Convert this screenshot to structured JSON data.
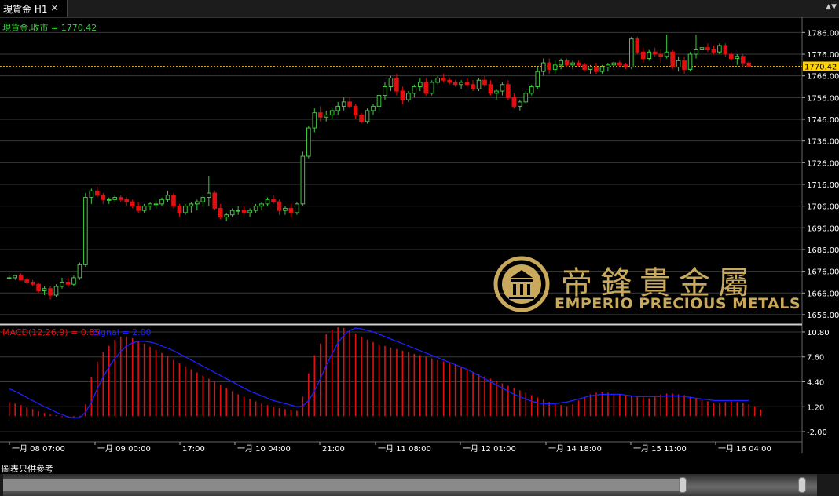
{
  "tab": {
    "title": "現貨金 H1",
    "close_label": "×",
    "menu_label": "▲▼"
  },
  "footer": {
    "note": "圖表只供參考"
  },
  "logo": {
    "chinese": "帝鋒貴金屬",
    "english": "EMPERIO PRECIOUS METALS"
  },
  "colors": {
    "bull": "#3fc93f",
    "bear": "#e01010",
    "grid": "#3a3a3a",
    "price_line": "#e0a020",
    "signal": "#1e1eff",
    "macd": "#e01010",
    "axis_text": "#ffffff",
    "date_text": "#ffdd00"
  },
  "chart_data": [
    {
      "type": "candlestick",
      "title": "現貨金,收市 = 1770.42",
      "symbol": "現貨金",
      "timeframe": "H1",
      "last_price": 1770.42,
      "ylim": [
        1652,
        1793
      ],
      "yticks": [
        1786.0,
        1776.0,
        1766.0,
        1756.0,
        1746.0,
        1736.0,
        1726.0,
        1716.0,
        1706.0,
        1696.0,
        1686.0,
        1676.0,
        1666.0,
        1656.0
      ],
      "xtick_labels": [
        "一月 08 07:00",
        "一月 09 00:00",
        "17:00",
        "一月 10 04:00",
        "21:00",
        "一月 11 08:00",
        "一月 12 01:00",
        "一月 14 18:00",
        "一月 15 11:00",
        "一月 16 04:00"
      ],
      "ohlc": [
        [
          1673,
          1674,
          1672,
          1673
        ],
        [
          1673,
          1674,
          1672,
          1674
        ],
        [
          1674,
          1675,
          1672,
          1672
        ],
        [
          1672,
          1673,
          1670,
          1671
        ],
        [
          1671,
          1672,
          1669,
          1670
        ],
        [
          1670,
          1671,
          1666,
          1667
        ],
        [
          1667,
          1669,
          1665,
          1668
        ],
        [
          1668,
          1669,
          1663,
          1665
        ],
        [
          1665,
          1670,
          1664,
          1669
        ],
        [
          1669,
          1673,
          1668,
          1671
        ],
        [
          1671,
          1673,
          1669,
          1670
        ],
        [
          1670,
          1674,
          1669,
          1673
        ],
        [
          1673,
          1680,
          1672,
          1679
        ],
        [
          1679,
          1712,
          1678,
          1710
        ],
        [
          1710,
          1714,
          1707,
          1713
        ],
        [
          1713,
          1715,
          1710,
          1711
        ],
        [
          1711,
          1712,
          1707,
          1709
        ],
        [
          1709,
          1710,
          1707,
          1709
        ],
        [
          1709,
          1711,
          1708,
          1710
        ],
        [
          1710,
          1711,
          1708,
          1709
        ],
        [
          1709,
          1710,
          1706,
          1708
        ],
        [
          1708,
          1709,
          1705,
          1706
        ],
        [
          1706,
          1708,
          1703,
          1704
        ],
        [
          1704,
          1707,
          1703,
          1706
        ],
        [
          1706,
          1708,
          1704,
          1707
        ],
        [
          1707,
          1709,
          1705,
          1707
        ],
        [
          1707,
          1710,
          1706,
          1709
        ],
        [
          1709,
          1713,
          1708,
          1711
        ],
        [
          1711,
          1712,
          1705,
          1706
        ],
        [
          1706,
          1707,
          1701,
          1703
        ],
        [
          1703,
          1707,
          1702,
          1706
        ],
        [
          1706,
          1708,
          1703,
          1707
        ],
        [
          1707,
          1709,
          1704,
          1708
        ],
        [
          1708,
          1711,
          1706,
          1710
        ],
        [
          1710,
          1720,
          1706,
          1712
        ],
        [
          1712,
          1713,
          1704,
          1705
        ],
        [
          1705,
          1707,
          1700,
          1701
        ],
        [
          1701,
          1703,
          1699,
          1702
        ],
        [
          1702,
          1705,
          1701,
          1704
        ],
        [
          1704,
          1706,
          1702,
          1704
        ],
        [
          1704,
          1706,
          1702,
          1703
        ],
        [
          1703,
          1705,
          1701,
          1704
        ],
        [
          1704,
          1707,
          1703,
          1706
        ],
        [
          1706,
          1708,
          1704,
          1707
        ],
        [
          1707,
          1710,
          1706,
          1709
        ],
        [
          1709,
          1711,
          1707,
          1708
        ],
        [
          1708,
          1709,
          1702,
          1704
        ],
        [
          1704,
          1706,
          1702,
          1705
        ],
        [
          1705,
          1707,
          1701,
          1703
        ],
        [
          1703,
          1708,
          1702,
          1707
        ],
        [
          1707,
          1731,
          1706,
          1729
        ],
        [
          1729,
          1743,
          1728,
          1742
        ],
        [
          1742,
          1751,
          1740,
          1749
        ],
        [
          1749,
          1752,
          1745,
          1747
        ],
        [
          1747,
          1750,
          1745,
          1748
        ],
        [
          1748,
          1751,
          1746,
          1750
        ],
        [
          1750,
          1754,
          1748,
          1752
        ],
        [
          1752,
          1756,
          1750,
          1754
        ],
        [
          1754,
          1756,
          1751,
          1752
        ],
        [
          1752,
          1753,
          1746,
          1748
        ],
        [
          1748,
          1749,
          1744,
          1745
        ],
        [
          1745,
          1751,
          1744,
          1750
        ],
        [
          1750,
          1753,
          1748,
          1752
        ],
        [
          1752,
          1758,
          1750,
          1757
        ],
        [
          1757,
          1763,
          1755,
          1761
        ],
        [
          1761,
          1766,
          1759,
          1765
        ],
        [
          1765,
          1767,
          1757,
          1759
        ],
        [
          1759,
          1761,
          1753,
          1755
        ],
        [
          1755,
          1759,
          1754,
          1758
        ],
        [
          1758,
          1762,
          1756,
          1761
        ],
        [
          1761,
          1765,
          1759,
          1763
        ],
        [
          1763,
          1765,
          1757,
          1758
        ],
        [
          1758,
          1764,
          1757,
          1763
        ],
        [
          1763,
          1766,
          1762,
          1765
        ],
        [
          1765,
          1767,
          1763,
          1764
        ],
        [
          1764,
          1765,
          1762,
          1763
        ],
        [
          1763,
          1764,
          1761,
          1762
        ],
        [
          1762,
          1764,
          1760,
          1763
        ],
        [
          1763,
          1765,
          1761,
          1762
        ],
        [
          1762,
          1764,
          1759,
          1760
        ],
        [
          1760,
          1765,
          1759,
          1764
        ],
        [
          1764,
          1766,
          1761,
          1762
        ],
        [
          1762,
          1764,
          1757,
          1758
        ],
        [
          1758,
          1760,
          1755,
          1759
        ],
        [
          1759,
          1763,
          1757,
          1762
        ],
        [
          1762,
          1764,
          1755,
          1756
        ],
        [
          1756,
          1758,
          1751,
          1752
        ],
        [
          1752,
          1755,
          1750,
          1754
        ],
        [
          1754,
          1759,
          1753,
          1758
        ],
        [
          1758,
          1762,
          1757,
          1761
        ],
        [
          1761,
          1770,
          1760,
          1768
        ],
        [
          1768,
          1774,
          1766,
          1772
        ],
        [
          1772,
          1774,
          1767,
          1769
        ],
        [
          1769,
          1773,
          1767,
          1771
        ],
        [
          1771,
          1774,
          1769,
          1773
        ],
        [
          1773,
          1774,
          1770,
          1771
        ],
        [
          1771,
          1773,
          1769,
          1772
        ],
        [
          1772,
          1773,
          1770,
          1771
        ],
        [
          1771,
          1772,
          1768,
          1769
        ],
        [
          1769,
          1771,
          1767,
          1770
        ],
        [
          1770,
          1772,
          1767,
          1768
        ],
        [
          1768,
          1771,
          1767,
          1770
        ],
        [
          1770,
          1772,
          1768,
          1771
        ],
        [
          1771,
          1773,
          1769,
          1772
        ],
        [
          1772,
          1773,
          1770,
          1771
        ],
        [
          1771,
          1772,
          1769,
          1770
        ],
        [
          1770,
          1784,
          1769,
          1783
        ],
        [
          1783,
          1784,
          1776,
          1777
        ],
        [
          1777,
          1779,
          1772,
          1774
        ],
        [
          1774,
          1778,
          1773,
          1777
        ],
        [
          1777,
          1779,
          1775,
          1776
        ],
        [
          1776,
          1778,
          1772,
          1775
        ],
        [
          1775,
          1785,
          1774,
          1777
        ],
        [
          1777,
          1778,
          1769,
          1770
        ],
        [
          1770,
          1775,
          1768,
          1773
        ],
        [
          1773,
          1775,
          1767,
          1769
        ],
        [
          1769,
          1777,
          1768,
          1776
        ],
        [
          1776,
          1785,
          1774,
          1778
        ],
        [
          1778,
          1780,
          1776,
          1779
        ],
        [
          1779,
          1781,
          1777,
          1778
        ],
        [
          1778,
          1780,
          1776,
          1777
        ],
        [
          1777,
          1781,
          1776,
          1780
        ],
        [
          1780,
          1781,
          1775,
          1776
        ],
        [
          1776,
          1777,
          1773,
          1774
        ],
        [
          1774,
          1776,
          1771,
          1775
        ],
        [
          1775,
          1776,
          1770,
          1772
        ],
        [
          1772,
          1773,
          1770,
          1770.42
        ]
      ]
    },
    {
      "type": "macd",
      "title": "MACD(12,26,9) = 0.85",
      "signal_label": "Signal = 2.00",
      "macd": 0.85,
      "signal": 2.0,
      "ylim": [
        -3.2,
        11.6
      ],
      "yticks": [
        10.8,
        7.6,
        4.4,
        1.2,
        -2.0
      ],
      "histogram": [
        1.8,
        1.6,
        1.4,
        1.1,
        0.9,
        0.6,
        0.4,
        0.2,
        0.1,
        0.0,
        -0.1,
        -0.2,
        -0.1,
        1.5,
        5.0,
        7.0,
        8.2,
        9.0,
        9.8,
        10.2,
        10.2,
        10.0,
        9.7,
        9.3,
        8.9,
        8.5,
        8.1,
        7.7,
        7.2,
        6.8,
        6.4,
        6.0,
        5.6,
        5.2,
        4.8,
        4.4,
        4.0,
        3.6,
        3.2,
        2.8,
        2.5,
        2.2,
        1.9,
        1.6,
        1.4,
        1.2,
        1.0,
        0.9,
        0.8,
        0.7,
        2.5,
        5.5,
        7.8,
        9.3,
        10.5,
        11.1,
        11.4,
        11.3,
        11.0,
        10.6,
        10.2,
        9.8,
        9.5,
        9.2,
        9.0,
        8.8,
        8.6,
        8.4,
        8.2,
        8.0,
        7.8,
        7.6,
        7.4,
        7.2,
        7.0,
        6.8,
        6.6,
        6.3,
        6.0,
        5.7,
        5.4,
        5.1,
        4.8,
        4.5,
        4.2,
        3.9,
        3.6,
        3.3,
        3.0,
        2.7,
        2.4,
        2.1,
        1.8,
        1.6,
        1.4,
        1.3,
        1.5,
        2.0,
        2.5,
        2.8,
        3.0,
        3.1,
        3.0,
        2.9,
        2.8,
        2.7,
        2.6,
        2.5,
        2.4,
        2.3,
        2.6,
        2.8,
        2.9,
        2.9,
        2.8,
        2.7,
        2.5,
        2.3,
        2.1,
        1.9,
        1.7,
        1.6,
        1.8,
        1.9,
        1.8,
        1.7,
        1.5,
        1.3,
        0.85
      ],
      "signal_series": [
        3.5,
        3.2,
        2.8,
        2.4,
        2.0,
        1.6,
        1.2,
        0.9,
        0.5,
        0.2,
        -0.1,
        -0.2,
        -0.2,
        0.5,
        1.8,
        3.5,
        5.0,
        6.3,
        7.4,
        8.3,
        9.0,
        9.4,
        9.6,
        9.6,
        9.5,
        9.3,
        9.0,
        8.7,
        8.4,
        8.0,
        7.6,
        7.2,
        6.8,
        6.4,
        6.0,
        5.6,
        5.2,
        4.8,
        4.4,
        4.0,
        3.6,
        3.2,
        2.9,
        2.6,
        2.3,
        2.0,
        1.8,
        1.6,
        1.4,
        1.2,
        1.3,
        2.0,
        3.2,
        4.8,
        6.5,
        8.0,
        9.4,
        10.4,
        11.0,
        11.3,
        11.2,
        11.0,
        10.8,
        10.5,
        10.2,
        9.9,
        9.6,
        9.3,
        9.0,
        8.7,
        8.4,
        8.1,
        7.8,
        7.5,
        7.2,
        6.9,
        6.6,
        6.3,
        6.0,
        5.6,
        5.2,
        4.8,
        4.4,
        4.0,
        3.6,
        3.2,
        2.8,
        2.5,
        2.2,
        1.9,
        1.7,
        1.6,
        1.6,
        1.6,
        1.7,
        1.8,
        2.0,
        2.2,
        2.4,
        2.6,
        2.7,
        2.8,
        2.8,
        2.8,
        2.8,
        2.7,
        2.6,
        2.5,
        2.5,
        2.5,
        2.5,
        2.5,
        2.6,
        2.6,
        2.6,
        2.5,
        2.4,
        2.3,
        2.2,
        2.1,
        2.0,
        2.0,
        2.0,
        2.0,
        2.0,
        2.0,
        2.0
      ]
    }
  ]
}
